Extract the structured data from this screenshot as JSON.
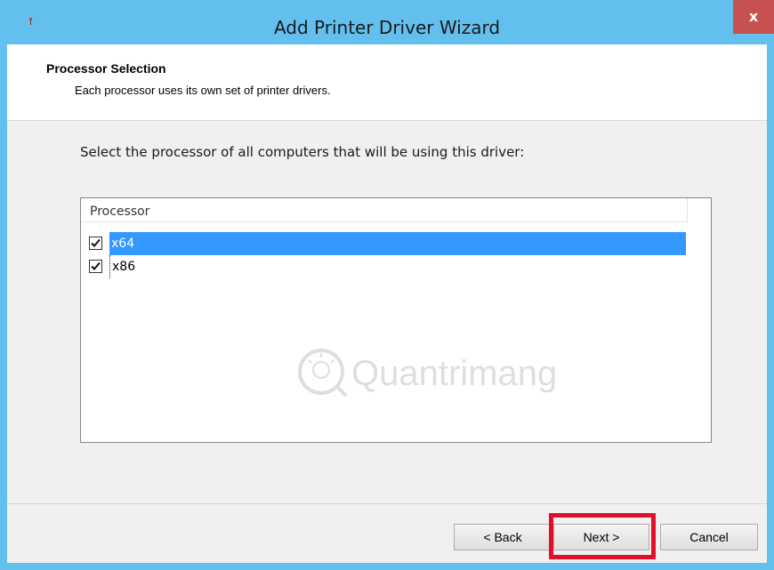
{
  "window": {
    "title": "Add Printer Driver Wizard",
    "close_label": "x"
  },
  "header": {
    "title": "Processor Selection",
    "subtitle": "Each processor uses its own set of printer drivers."
  },
  "prompt": "Select the processor of all computers that will be using this driver:",
  "listbox": {
    "column_header": "Processor",
    "items": [
      {
        "label": "x64",
        "checked": true,
        "selected": true
      },
      {
        "label": "x86",
        "checked": true,
        "selected": false
      }
    ]
  },
  "watermark": "Quantrimang",
  "buttons": {
    "back": "< Back",
    "next": "Next >",
    "cancel": "Cancel"
  },
  "colors": {
    "titlebar": "#63bfee",
    "close": "#c75050",
    "selection": "#3399ff",
    "highlight": "#e0102b"
  }
}
